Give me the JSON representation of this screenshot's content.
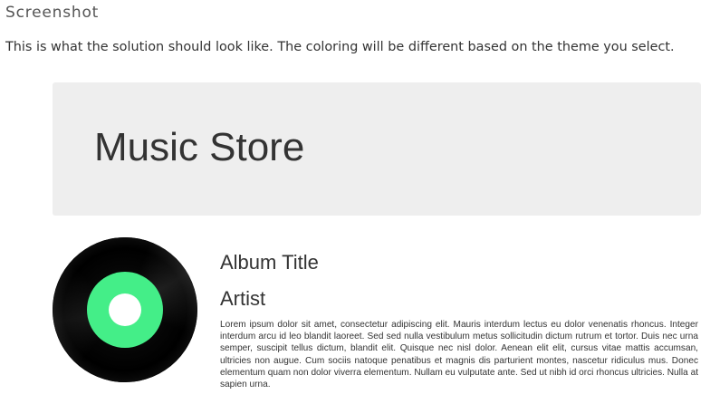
{
  "page": {
    "heading": "Screenshot",
    "intro": "This is what the solution should look like. The coloring will be different based on the theme you select."
  },
  "jumbotron": {
    "title": "Music Store"
  },
  "album": {
    "title": "Album Title",
    "artist": "Artist",
    "description": "Lorem ipsum dolor sit amet, consectetur adipiscing elit. Mauris interdum lectus eu dolor venenatis rhoncus. Integer interdum arcu id leo blandit laoreet. Sed sed nulla vestibulum metus sollicitudin dictum rutrum et tortor. Duis nec urna semper, suscipit tellus dictum, blandit elit. Quisque nec nisl dolor. Aenean elit elit, cursus vitae mattis accumsan, ultricies non augue. Cum sociis natoque penatibus et magnis dis parturient montes, nascetur ridiculus mus. Donec elementum quam non dolor viverra elementum. Nullam eu vulputate ante. Sed ut nibh id orci rhoncus ultricies. Nulla at sapien urna.",
    "cover_icon": "vinyl-record-icon"
  },
  "colors": {
    "jumbotron_background": "#eeeeee",
    "record_label": "#44ee88",
    "record_body": "#000000",
    "text": "#333333"
  }
}
